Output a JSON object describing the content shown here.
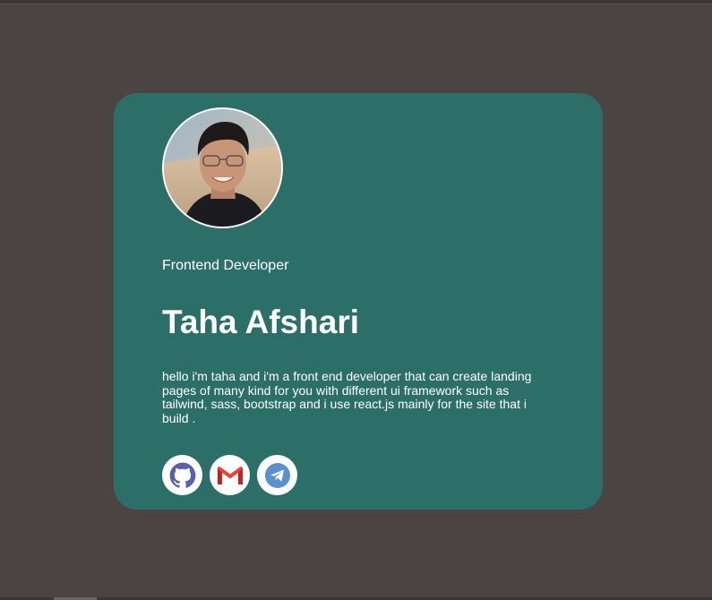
{
  "profile": {
    "role": "Frontend Developer",
    "name": "Taha Afshari",
    "bio": "hello i'm taha and i'm a front end developer that can create landing pages of many kind for you with different ui framework such as tailwind, sass, bootstrap and i use react.js mainly for the site that i build ."
  },
  "socials": [
    {
      "icon": "github-icon",
      "color": "#5a5fb0"
    },
    {
      "icon": "gmail-icon",
      "color": "#ea4335"
    },
    {
      "icon": "telegram-icon",
      "color": "#5b8fd1"
    }
  ],
  "colors": {
    "background": "#4a4543",
    "card": "#2c6f69",
    "text": "#ffffff"
  }
}
